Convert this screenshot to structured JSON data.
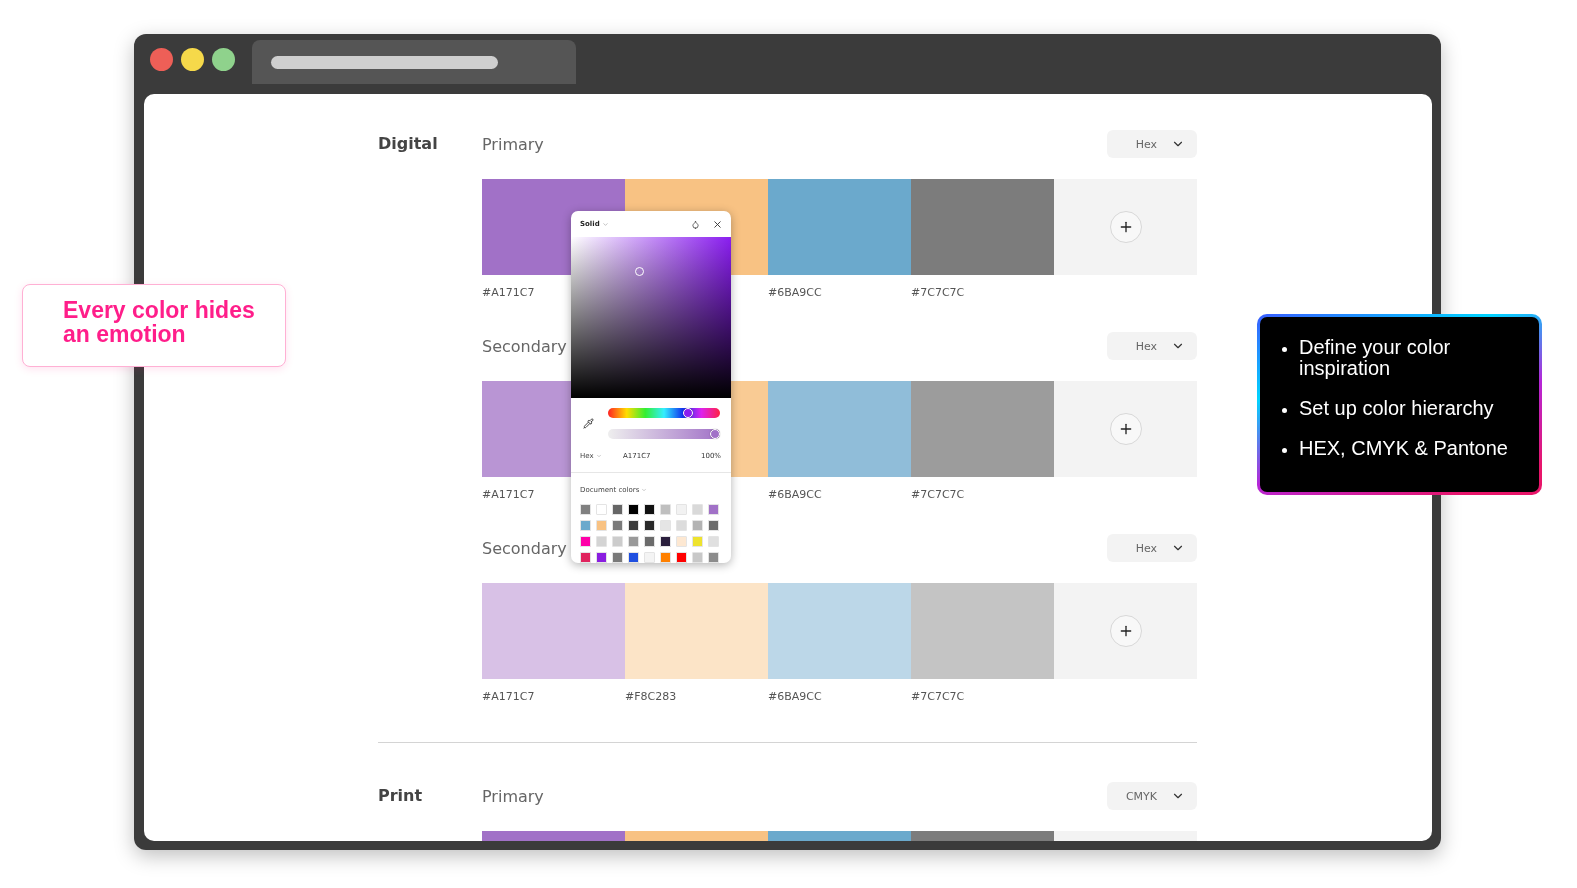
{
  "sections": [
    {
      "title": "Digital",
      "palettes": [
        {
          "name": "Primary",
          "format": "Hex",
          "add_button": true,
          "swatches": [
            {
              "color": "#a171c7",
              "label": "#A171C7"
            },
            {
              "color": "#f8c283"
            },
            {
              "color": "#6ba9cc",
              "label": "#6BA9CC"
            },
            {
              "color": "#7c7c7c",
              "label": "#7C7C7C"
            }
          ]
        },
        {
          "name": "Secondary",
          "format": "Hex",
          "add_button": true,
          "swatches": [
            {
              "color": "#b995d4",
              "label": "#A171C7"
            },
            {
              "color": "#f9cb94"
            },
            {
              "color": "#90bdd9",
              "label": "#6BA9CC"
            },
            {
              "color": "#9c9c9c",
              "label": "#7C7C7C"
            }
          ]
        },
        {
          "name": "Secondary",
          "format": "Hex",
          "add_button": true,
          "swatches": [
            {
              "color": "#d8c1e6",
              "label": "#A171C7"
            },
            {
              "color": "#fce4c7",
              "label": "#F8C283"
            },
            {
              "color": "#bcd7e8",
              "label": "#6BA9CC"
            },
            {
              "color": "#c4c4c4",
              "label": "#7C7C7C"
            }
          ]
        }
      ]
    },
    {
      "title": "Print",
      "palettes": [
        {
          "name": "Primary",
          "format": "CMYK",
          "swatches": [
            {
              "color": "#a171c7"
            },
            {
              "color": "#f8c283"
            },
            {
              "color": "#6ba9cc"
            },
            {
              "color": "#7c7c7c"
            }
          ]
        }
      ]
    }
  ],
  "color_picker": {
    "fill_type": "Solid",
    "hue": {
      "level": 0.74
    },
    "opacity": {
      "level": 1
    },
    "format": "Hex",
    "value": "A171C7",
    "opacity_reading": "100%",
    "library": "Document colors",
    "colors": [
      {
        "color": "#808080"
      },
      {
        "color": "#ffffff"
      },
      {
        "color": "#666666"
      },
      {
        "color": "#000000"
      },
      {
        "color": "#111111"
      },
      {
        "color": "#bfbfbf"
      },
      {
        "color": "#f2f2f2"
      },
      {
        "color": "#d9d9d9"
      },
      {
        "color": "#a171c7"
      },
      {
        "color": "#6ba9cc"
      },
      {
        "color": "#f8c283"
      },
      {
        "color": "#7a7a7a"
      },
      {
        "color": "#3a3a3a"
      },
      {
        "color": "#2a2a2a"
      },
      {
        "color": "#e5e5e5"
      },
      {
        "color": "#dcdcdc"
      },
      {
        "color": "#b3b3b3"
      },
      {
        "color": "#6b6b6b"
      },
      {
        "color": "#ff00a8"
      },
      {
        "color": "#d4d4d4"
      },
      {
        "color": "#cccccc"
      },
      {
        "color": "#999999"
      },
      {
        "color": "#6b6b6b"
      },
      {
        "color": "#2a1f3d"
      },
      {
        "color": "#fde8d2"
      },
      {
        "color": "#eee32e"
      },
      {
        "color": "#e0e0e0"
      },
      {
        "color": "#e0245e"
      },
      {
        "color": "#8a1ee0"
      },
      {
        "color": "#7a7a7a"
      },
      {
        "color": "#1f4fe0"
      },
      {
        "color": "#f4f4f4"
      },
      {
        "color": "#ff8000"
      },
      {
        "color": "#ff0000"
      },
      {
        "color": "#c8c8c8"
      },
      {
        "color": "#8c8c8c"
      }
    ]
  },
  "callouts": [
    {
      "kind": "headline",
      "text": "Every color hides an emotion"
    },
    {
      "kind": "list",
      "items": [
        "Define your color inspiration",
        "Set up color hierarchy",
        "HEX, CMYK & Pantone"
      ]
    }
  ]
}
